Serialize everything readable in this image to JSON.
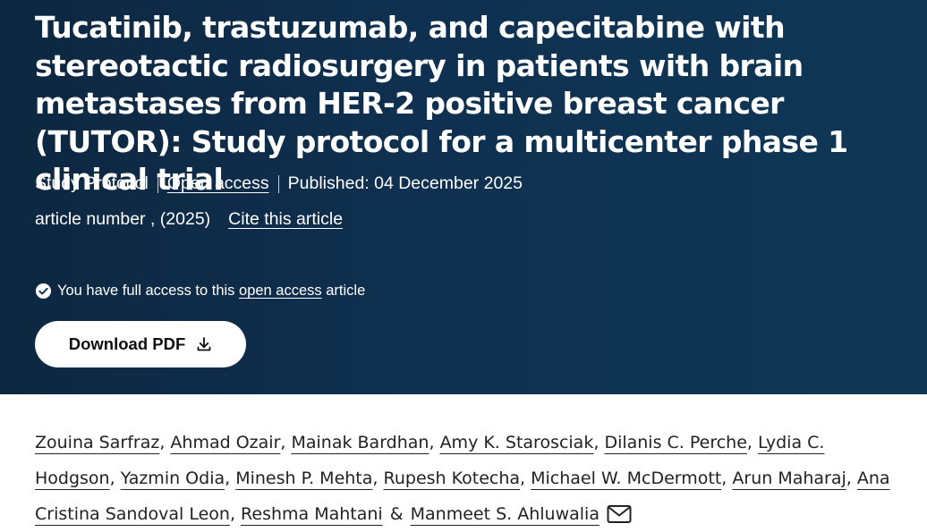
{
  "article": {
    "title": "Tucatinib, trastuzumab, and capecitabine with stereotactic radiosurgery in patients with brain metastases from HER-2 positive breast cancer (TUTOR): Study protocol for a multicenter phase 1 clinical trial",
    "type": "Study Protocol",
    "access_label": "Open access",
    "published": "Published: 04 December 2025",
    "article_number": "article number , (2025)",
    "cite_label": "Cite this article"
  },
  "access_notice": {
    "prefix": "You have full access to this ",
    "link": "open access",
    "suffix": " article"
  },
  "download": {
    "label": "Download PDF",
    "icon": "download-icon"
  },
  "authors": [
    "Zouina Sarfraz",
    "Ahmad Ozair",
    "Mainak Bardhan",
    "Amy K. Starosciak",
    "Dilanis C. Perche",
    "Lydia C. Hodgson",
    "Yazmin Odia",
    "Minesh P. Mehta",
    "Rupesh Kotecha",
    "Michael W. McDermott",
    "Arun Maharaj",
    "Ana Cristina Sandoval Leon",
    "Reshma Mahtani",
    "Manmeet S. Ahluwalia"
  ],
  "authors_sep": ", ",
  "authors_last_sep": "&",
  "contact_icon": "envelope-icon",
  "colors": {
    "hero_bg": "#0f3050",
    "button_bg": "#ffffff",
    "text_dark": "#222222"
  }
}
